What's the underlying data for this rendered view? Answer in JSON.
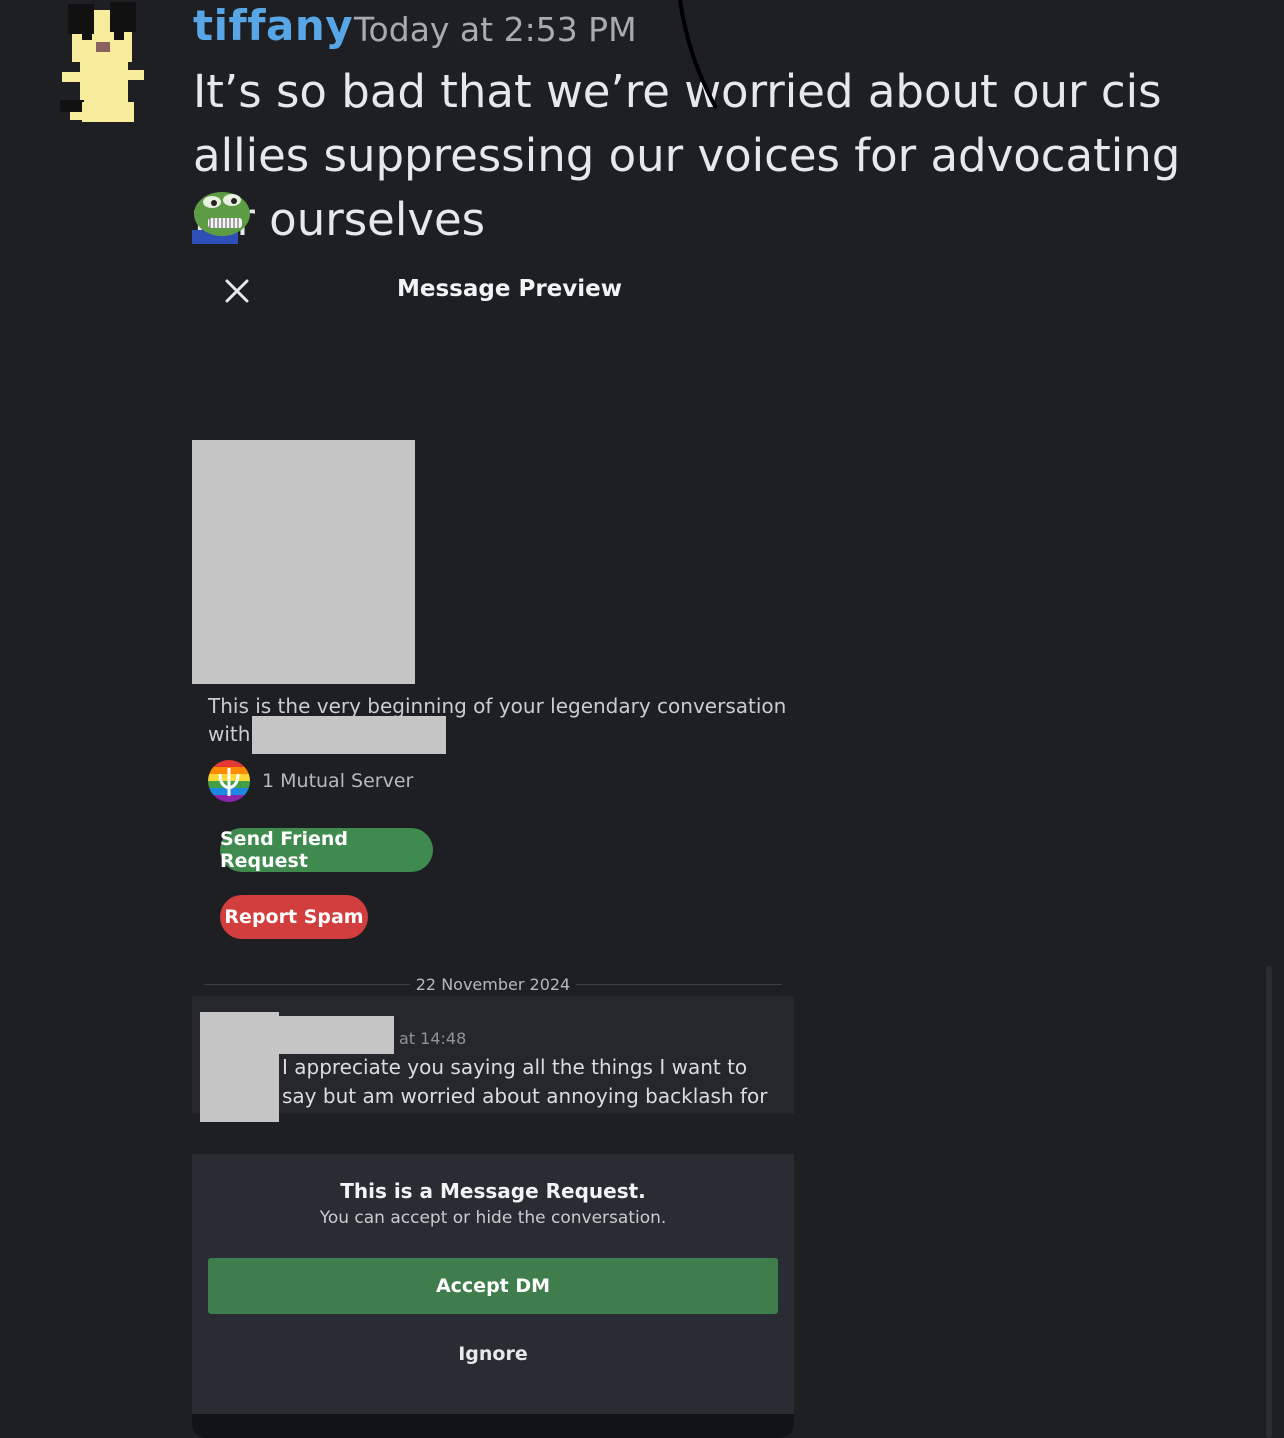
{
  "message": {
    "username": "tiffany",
    "timestamp": "Today at 2:53 PM",
    "text": "It’s so bad that we’re worried about our cis allies suppressing our voices for advocating for ourselves",
    "emoji_icon": "pepe-grin-emoji-icon"
  },
  "preview": {
    "title": "Message Preview",
    "intro_text": "This is the very beginning of your legendary conversation with",
    "mutual_servers": "1 Mutual Server",
    "send_friend_request": "Send Friend Request",
    "report_spam": "Report Spam",
    "date_divider": "22 November 2024",
    "dm_time": "at 14:48",
    "dm_text": "I appreciate you saying all the things I want to say but am worried about annoying backlash for",
    "request_title": "This is a Message Request.",
    "request_subtitle": "You can accept or hide the conversation.",
    "accept_label": "Accept DM",
    "ignore_label": "Ignore"
  },
  "colors": {
    "background": "#1e1f23",
    "username": "#58a6e6",
    "green_button": "#3f8a4f",
    "red_button": "#d23d3d",
    "redaction": "#c5c5c5"
  }
}
